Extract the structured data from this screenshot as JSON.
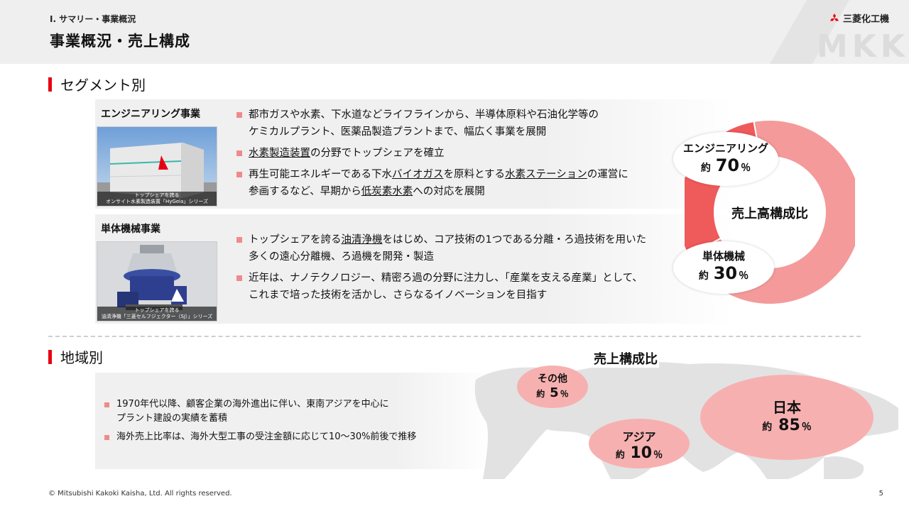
{
  "header": {
    "section": "Ⅰ. サマリー・事業概況",
    "title": "事業概況・売上構成",
    "logo_text": "三菱化工機",
    "watermark": "MKK"
  },
  "segment": {
    "heading": "セグメント別",
    "rows": [
      {
        "label": "エンジニアリング事業",
        "photo_caption_1": "トップシェアを誇る",
        "photo_caption_2": "オンサイト水素製造装置「HyGeia」シリーズ",
        "bullets": [
          [
            "都市ガスや水素、下水道などライフラインから、半導体原料や石油化学等の",
            "ケミカルプラント、医薬品製造プラントまで、幅広く事業を展開"
          ],
          [
            "水素製造装置",
            "の分野でトップシェアを確立"
          ],
          [
            "再生可能エネルギーである下水",
            "バイオガス",
            "を原料とする",
            "水素ステーション",
            "の運営に",
            "参画するなど、早期から",
            "低炭素水素",
            "への対応を展開"
          ]
        ]
      },
      {
        "label": "単体機械事業",
        "photo_caption_1": "トップシェアを誇る",
        "photo_caption_2": "油清浄機「三菱セルフジェクター（SJ）」シリーズ",
        "bullets": [
          [
            "トップシェアを誇る",
            "油清浄機",
            "をはじめ、コア技術の1つである分離・ろ過技術を用いた",
            "多くの遠心分離機、ろ過機を開発・製造"
          ],
          [
            "近年は、ナノテクノロジー、精密ろ過の分野に注力し、「産業を支える産業」として、",
            "これまで培った技術を活かし、さらなるイノベーションを目指す"
          ]
        ]
      }
    ],
    "chart": {
      "center_label": "売上高構成比",
      "prefix": "約",
      "unit": "％"
    }
  },
  "chart_data": [
    {
      "type": "pie",
      "title": "売上高構成比",
      "categories": [
        "エンジニアリング",
        "単体機械"
      ],
      "values": [
        70,
        30
      ],
      "colors": [
        "#f49a9a",
        "#ef5a5a"
      ]
    },
    {
      "type": "pie",
      "title": "売上構成比",
      "categories": [
        "日本",
        "アジア",
        "その他"
      ],
      "values": [
        85,
        10,
        5
      ],
      "colors": [
        "#f7b0b0",
        "#f7b0b0",
        "#f7b0b0"
      ]
    }
  ],
  "region": {
    "heading": "地域別",
    "bullets": [
      [
        "1970年代以降、顧客企業の海外進出に伴い、東南アジアを中心に",
        "プラント建設の実績を蓄積"
      ],
      [
        "海外売上比率は、海外大型工事の受注金額に応じて10～30%前後で推移"
      ]
    ],
    "chart_title": "売上構成比",
    "prefix": "約",
    "unit": "％"
  },
  "footer": {
    "copyright": "© Mitsubishi Kakoki Kaisha, Ltd. All rights reserved.",
    "page": "5"
  }
}
